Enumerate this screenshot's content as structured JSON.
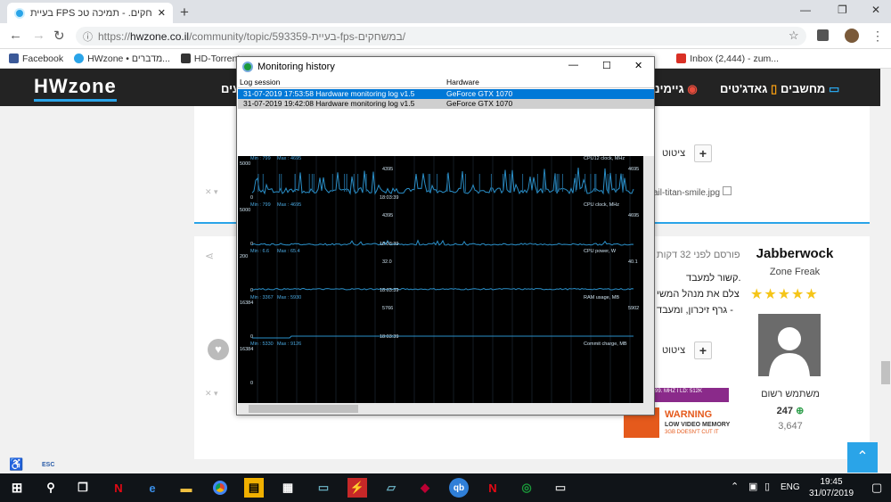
{
  "browser": {
    "tab_title": "בעיית FPS במשחקים. - תמיכה טכ",
    "url_prefix": "https://",
    "url_domain": "hwzone.co.il",
    "url_path": "/community/topic/593359-בעיית-fps-במשחקים/",
    "bookmarks": [
      {
        "label": "Facebook",
        "color": "#3b5998"
      },
      {
        "label": "HWzone • מדברים...",
        "color": "#2aa4e8"
      },
      {
        "label": "HD-Torrent",
        "color": "#333333"
      },
      {
        "label": "Inbox (2,444) - zum...",
        "color": "#d93025"
      }
    ]
  },
  "site": {
    "logo": "HWzone",
    "nav": [
      "מחשבים",
      "גאדג'טים",
      "גיימינ",
      "עים"
    ]
  },
  "post": {
    "quote_label": "ציטוט",
    "plus": "+",
    "time_label": "פורסם לפני 32 דקות",
    "lines": [
      "קשור למעבד.",
      "צלם את מנהל המשי",
      "גרף זיכרון, ומעבד -"
    ],
    "image_link": "ail-titan-smile.jpg",
    "author": {
      "name": "Jabberwock",
      "rank": "Zone Freak",
      "stars": 5,
      "status": "משתמש רשום",
      "reputation": "247",
      "posts": "3,647"
    },
    "ad_text": "99. MHZ I LD: 512K",
    "ad_warning": "WARNING",
    "ad_sub": "LOW VIDEO MEMORY",
    "ad_sub2": "3GB DOESN'T CUT IT"
  },
  "dialog": {
    "title": "Monitoring history",
    "col_session": "Log session",
    "col_hardware": "Hardware",
    "rows": [
      {
        "session": "31-07-2019 17:53:58 Hardware monitoring log v1.5",
        "hardware": "GeForce GTX 1070",
        "selected": true
      },
      {
        "session": "31-07-2019 19:42:08 Hardware monitoring log v1.5",
        "hardware": "GeForce GTX 1070",
        "selected": false
      }
    ]
  },
  "chart_data": {
    "type": "line",
    "panels": [
      {
        "name": "CPU12 clock, MHz",
        "min_label": "Min : 799",
        "max_label": "Max : 4695",
        "ymax": "5000",
        "ymin": "0",
        "time": "18:03:39",
        "current": "4395",
        "right": "4695"
      },
      {
        "name": "CPU clock, MHz",
        "min_label": "Min : 799",
        "max_label": "Max : 4695",
        "ymax": "5000",
        "ymin": "0",
        "time": "18:03:39",
        "current": "4395",
        "right": "4695"
      },
      {
        "name": "CPU power, W",
        "min_label": "Min : 6.6",
        "max_label": "Max : 65.4",
        "ymax": "200",
        "ymin": "0",
        "time": "18:03:39",
        "current": "32.0",
        "right": "40.1"
      },
      {
        "name": "RAM usage, MB",
        "min_label": "Min : 3367",
        "max_label": "Max : 5930",
        "ymax": "16384",
        "ymin": "0",
        "time": "18:03:39",
        "current": "5766",
        "right": "5902"
      },
      {
        "name": "Commit charge, MB",
        "min_label": "Min : 5330",
        "max_label": "Max : 9126",
        "ymax": "16384",
        "ymin": "0",
        "time": "18:03:39",
        "current": "",
        "right": ""
      }
    ]
  },
  "taskbar": {
    "lang": "ENG",
    "time": "19:45",
    "date": "31/07/2019",
    "esc": "ESC"
  }
}
